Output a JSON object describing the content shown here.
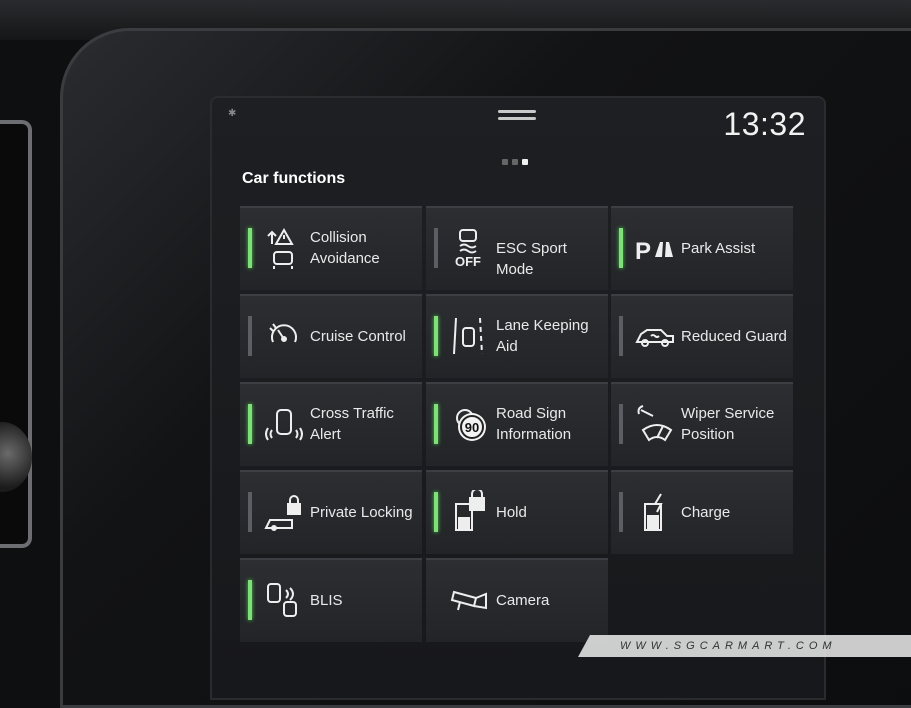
{
  "status": {
    "time": "13:32"
  },
  "page": {
    "title": "Car functions",
    "pager": {
      "count": 3,
      "current": 3
    }
  },
  "tiles": [
    {
      "label1": "Collision",
      "label2": "Avoidance",
      "icon": "collision-avoidance-icon",
      "active": true
    },
    {
      "label1": "ESC Sport Mode",
      "label2": "",
      "icon": "esc-off-icon",
      "active": false
    },
    {
      "label1": "Park Assist",
      "label2": "",
      "icon": "park-assist-icon",
      "active": true
    },
    {
      "label1": "Cruise Control",
      "label2": "",
      "icon": "cruise-control-icon",
      "active": false
    },
    {
      "label1": "Lane Keeping",
      "label2": "Aid",
      "icon": "lane-keeping-icon",
      "active": true
    },
    {
      "label1": "Reduced Guard",
      "label2": "",
      "icon": "reduced-guard-icon",
      "active": false
    },
    {
      "label1": "Cross Traffic",
      "label2": "Alert",
      "icon": "cross-traffic-icon",
      "active": true
    },
    {
      "label1": "Road Sign",
      "label2": "Information",
      "icon": "road-sign-icon",
      "active": true
    },
    {
      "label1": "Wiper Service",
      "label2": "Position",
      "icon": "wiper-service-icon",
      "active": false
    },
    {
      "label1": "Private Locking",
      "label2": "",
      "icon": "private-locking-icon",
      "active": false
    },
    {
      "label1": "Hold",
      "label2": "",
      "icon": "hold-icon",
      "active": true
    },
    {
      "label1": "Charge",
      "label2": "",
      "icon": "charge-icon",
      "active": false
    },
    {
      "label1": "BLIS",
      "label2": "",
      "icon": "blis-icon",
      "active": true
    },
    {
      "label1": "Camera",
      "label2": "",
      "icon": "camera-icon",
      "active": null
    }
  ],
  "icon_glyphs": {
    "road_sign_speed": "90",
    "esc_off": "OFF",
    "park": "P"
  },
  "colors": {
    "active_indicator": "#7fe07a",
    "inactive_indicator": "#5b5e63",
    "tile_bg": "#2a2c30"
  },
  "watermark": "WWW.SGCARMART.COM"
}
